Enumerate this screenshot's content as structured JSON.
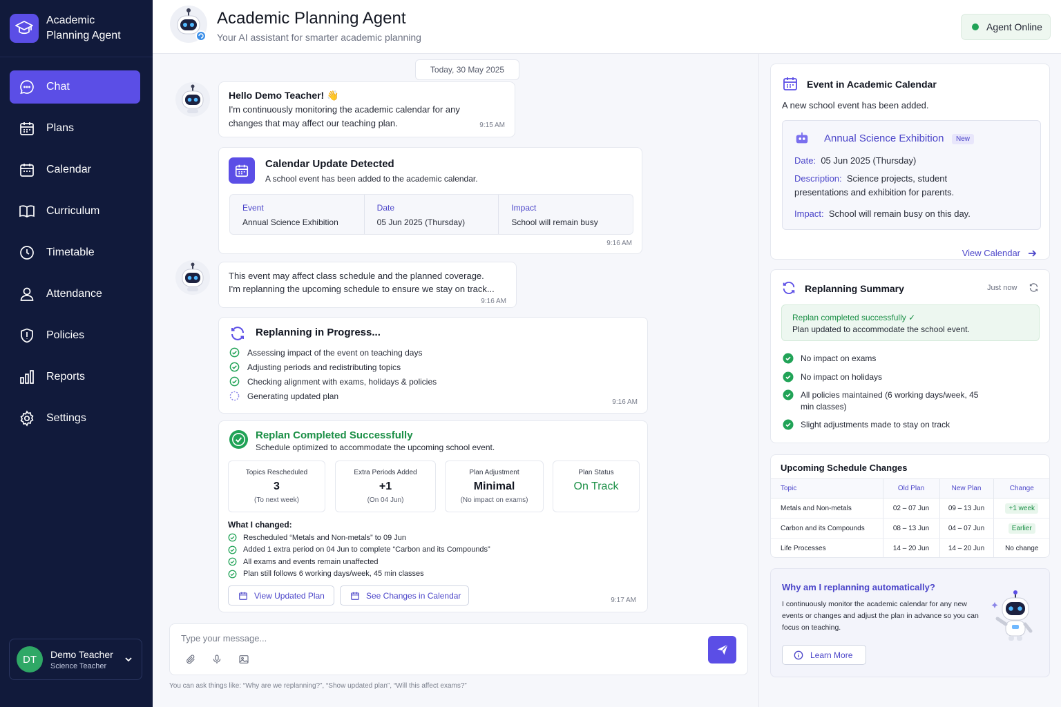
{
  "app": {
    "brand_name": "Academic Planning Agent",
    "title": "Academic Planning Agent",
    "subtitle": "Your AI assistant for smarter academic planning",
    "status": "Agent Online"
  },
  "sidebar": {
    "items": [
      {
        "label": "Chat",
        "icon": "chat-icon",
        "active": true
      },
      {
        "label": "Plans",
        "icon": "plans-icon"
      },
      {
        "label": "Calendar",
        "icon": "calendar-icon"
      },
      {
        "label": "Curriculum",
        "icon": "book-icon"
      },
      {
        "label": "Timetable",
        "icon": "clock-icon"
      },
      {
        "label": "Attendance",
        "icon": "user-icon"
      },
      {
        "label": "Policies",
        "icon": "shield-icon"
      },
      {
        "label": "Reports",
        "icon": "bar-chart-icon"
      },
      {
        "label": "Settings",
        "icon": "gear-icon"
      }
    ],
    "user": {
      "initials": "DT",
      "name": "Demo Teacher",
      "role": "Science Teacher"
    }
  },
  "chat": {
    "date": "Today, 30 May 2025",
    "greeting": {
      "title": "Hello Demo Teacher! 👋",
      "text": "I'm continuously monitoring the academic calendar for any changes that may affect our teaching plan.",
      "time": "9:15 AM"
    },
    "update": {
      "title": "Calendar Update Detected",
      "text": "A school event has been added to the academic calendar.",
      "event_label": "Event",
      "event_value": "Annual Science Exhibition",
      "date_label": "Date",
      "date_value": "05 Jun 2025 (Thursday)",
      "impact_label": "Impact",
      "impact_value": "School will remain busy",
      "time": "9:16 AM"
    },
    "affect": {
      "line1": "This event may affect class schedule and the planned coverage.",
      "line2": "I'm replanning the upcoming schedule to ensure we stay on track...",
      "time": "9:16 AM"
    },
    "progress": {
      "title": "Replanning in Progress...",
      "steps": [
        {
          "label": "Assessing impact of the event on teaching days",
          "done": true
        },
        {
          "label": "Adjusting periods and redistributing topics",
          "done": true
        },
        {
          "label": "Checking alignment with exams, holidays & policies",
          "done": true
        },
        {
          "label": "Generating updated plan",
          "done": false
        }
      ],
      "time": "9:16 AM"
    },
    "complete": {
      "title": "Replan Completed Successfully",
      "text": "Schedule optimized to accommodate the upcoming school event.",
      "stats": [
        {
          "label": "Topics Rescheduled",
          "value": "3",
          "sub": "(To next week)"
        },
        {
          "label": "Extra Periods Added",
          "value": "+1",
          "sub": "(On 04 Jun)"
        },
        {
          "label": "Plan Adjustment",
          "value": "Minimal",
          "sub": "(No impact on exams)"
        },
        {
          "label": "Plan Status",
          "value": "On Track",
          "sub": ""
        }
      ],
      "changes_title": "What I changed:",
      "changes": [
        "Rescheduled “Metals and Non-metals” to 09 Jun",
        "Added 1 extra period on 04 Jun to complete “Carbon and its Compounds”",
        "All exams and events remain unaffected",
        "Plan still follows 6 working days/week, 45 min classes"
      ],
      "view_plan": "View Updated Plan",
      "see_changes": "See Changes in Calendar",
      "time": "9:17 AM"
    },
    "input_placeholder": "Type your message...",
    "hint": "You can ask things like: “Why are we replanning?”, “Show updated plan”, “Will this affect exams?”"
  },
  "right": {
    "event": {
      "title": "Event in Academic Calendar",
      "text": "A new school event has been added.",
      "name": "Annual Science Exhibition",
      "badge": "New",
      "date_label": "Date:",
      "date_value": "05 Jun 2025 (Thursday)",
      "desc_label": "Description:",
      "desc_value": "Science projects, student presentations and exhibition for parents.",
      "impact_label": "Impact:",
      "impact_value": "School will remain busy on this day.",
      "link": "View Calendar"
    },
    "summary": {
      "title": "Replanning Summary",
      "time": "Just now",
      "success_title": "Replan completed successfully ✓",
      "success_text": "Plan updated to accommodate the school event.",
      "items": [
        "No impact on exams",
        "No impact on holidays",
        "All policies maintained (6 working days/week, 45 min classes)",
        "Slight adjustments made to stay on track"
      ]
    },
    "schedule": {
      "title": "Upcoming Schedule Changes",
      "headers": [
        "Topic",
        "Old Plan",
        "New Plan",
        "Change"
      ],
      "rows": [
        [
          "Metals and Non-metals",
          "02 – 07 Jun",
          "09 – 13 Jun",
          "+1 week"
        ],
        [
          "Carbon and its Compounds",
          "08 – 13 Jun",
          "04 – 07 Jun",
          "Earlier"
        ],
        [
          "Life Processes",
          "14 – 20 Jun",
          "14 – 20 Jun",
          "No change"
        ]
      ]
    },
    "why": {
      "title": "Why am I replanning automatically?",
      "text": "I continuously monitor the academic calendar for any new events or changes and adjust the plan in advance so you can focus on teaching.",
      "button": "Learn More"
    }
  },
  "colors": {
    "accent": "#5b4ee6",
    "sidebar": "#111a3b",
    "success": "#21a357"
  }
}
